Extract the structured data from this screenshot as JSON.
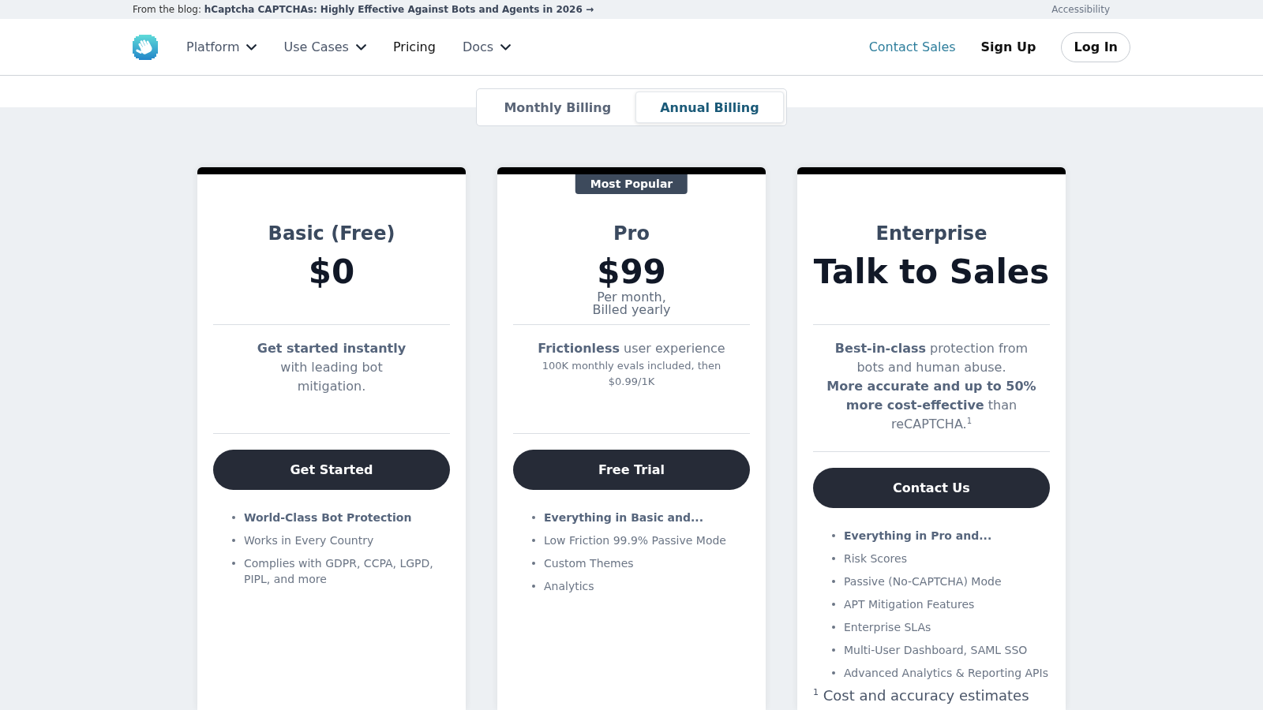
{
  "blog_banner": {
    "prefix": "From the blog:",
    "link": "hCaptcha CAPTCHAs: Highly Effective Against Bots and Agents in 2026 →"
  },
  "accessibility_link": "Accessibility",
  "nav": {
    "items": [
      {
        "label": "Platform",
        "kind": "dropdown",
        "selected": false
      },
      {
        "label": "Use Cases",
        "kind": "dropdown",
        "selected": false
      },
      {
        "label": "Pricing",
        "kind": "link",
        "selected": true
      },
      {
        "label": "Docs",
        "kind": "dropdown",
        "selected": false
      }
    ],
    "actions": [
      {
        "label": "Contact Sales",
        "kind": "accent"
      },
      {
        "label": "Sign Up",
        "kind": "bold"
      },
      {
        "label": "Log In",
        "kind": "outlined"
      }
    ]
  },
  "billing_toggle": [
    {
      "label": "Monthly Billing",
      "selected": false
    },
    {
      "label": "Annual Billing",
      "selected": true
    }
  ],
  "plans": [
    {
      "name": "Basic (Free)",
      "price": "$0",
      "description": [
        {
          "kind": "lead",
          "text": "**Get started instantly** with leading bot mitigation."
        }
      ],
      "button": "Get Started",
      "features": [
        {
          "text": "World-Class Bot Protection",
          "bold": true
        },
        {
          "text": "Works in Every Country",
          "bold": false
        },
        {
          "text": "Complies with GDPR, CCPA, LGPD, PIPL, and more",
          "bold": false
        }
      ]
    },
    {
      "name": "Pro",
      "badge": "Most Popular",
      "price": "$99",
      "price_note": "Per month, Billed yearly",
      "description": [
        {
          "kind": "lead",
          "text": "**Frictionless** user experience"
        },
        {
          "kind": "note",
          "text": "100K monthly evals included, then $0.99/1K"
        }
      ],
      "button": "Free Trial",
      "features": [
        {
          "text": "Everything in Basic and...",
          "bold": true
        },
        {
          "text": "Low Friction 99.9% Passive Mode",
          "bold": false
        },
        {
          "text": "Custom Themes",
          "bold": false
        },
        {
          "text": "Analytics",
          "bold": false
        }
      ]
    },
    {
      "name": "Enterprise",
      "price": "Talk to Sales",
      "description": [
        {
          "kind": "lead",
          "text": "**Best-in-class** protection from bots and human abuse."
        },
        {
          "kind": "lead",
          "text": "**More accurate and up to 50% more cost-effective** than reCAPTCHA.$^{1}$"
        }
      ],
      "button": "Contact Us",
      "features": [
        {
          "text": "Everything in Pro and...",
          "bold": true
        },
        {
          "text": "Risk Scores",
          "bold": false
        },
        {
          "text": "Passive (No-CAPTCHA) Mode",
          "bold": false
        },
        {
          "text": "APT Mitigation Features",
          "bold": false
        },
        {
          "text": "Enterprise SLAs",
          "bold": false
        },
        {
          "text": "Multi-User Dashboard, SAML SSO",
          "bold": false
        },
        {
          "text": "Advanced Analytics & Reporting APIs",
          "bold": false
        }
      ],
      "footnote": "$^{1}$ Cost and accuracy estimates"
    }
  ]
}
